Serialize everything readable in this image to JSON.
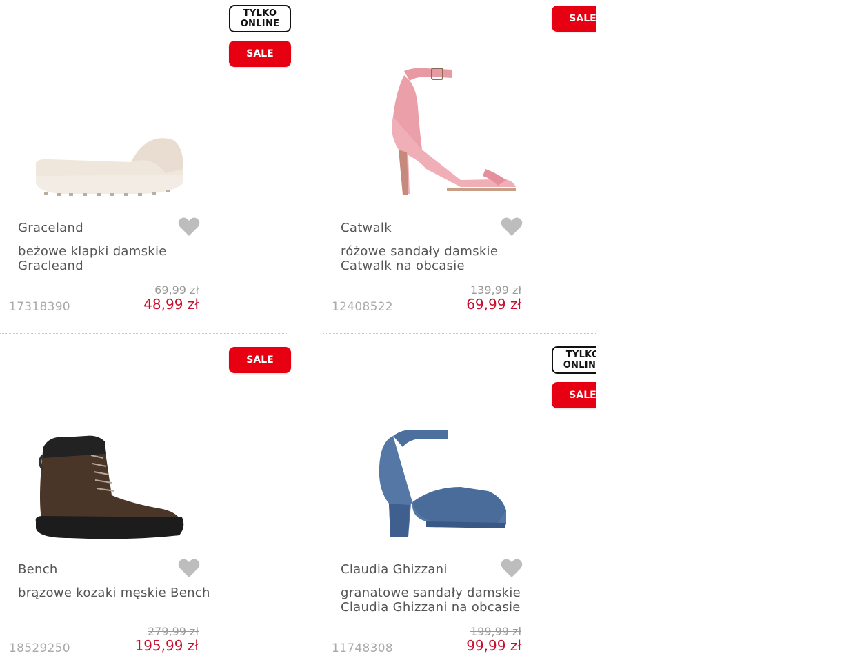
{
  "colors": {
    "sale_red": "#e60012",
    "price_red": "#c8102e",
    "text_gray": "#555555",
    "muted_gray": "#999999",
    "heart_gray": "#bdbdbd"
  },
  "badges": {
    "online_line1": "TYLKO",
    "online_line2": "ONLINE",
    "sale": "SALE"
  },
  "products": [
    {
      "brand": "Graceland",
      "name": "beżowe klapki damskie Gracleand",
      "old_price": "69,99 zł",
      "new_price": "48,99 zł",
      "sku": "17318390",
      "image_icon": "beige-slide-sandal",
      "badges": [
        "TYLKO ONLINE",
        "SALE"
      ]
    },
    {
      "brand": "Catwalk",
      "name": "różowe sandały damskie Catwalk na obcasie",
      "old_price": "139,99 zł",
      "new_price": "69,99 zł",
      "sku": "12408522",
      "image_icon": "pink-heeled-sandal",
      "badges": [
        "SALE"
      ]
    },
    {
      "brand": "Bench",
      "name": "brązowe kozaki męskie Bench",
      "old_price": "279,99 zł",
      "new_price": "195,99 zł",
      "sku": "18529250",
      "image_icon": "brown-ankle-boot",
      "badges": [
        "SALE"
      ]
    },
    {
      "brand": "Claudia Ghizzani",
      "name": "granatowe sandały damskie Claudia Ghizzani na obcasie",
      "old_price": "199,99 zł",
      "new_price": "99,99 zł",
      "sku": "11748308",
      "image_icon": "denim-platform-heel",
      "badges": [
        "TYLKO ONLINE",
        "SALE"
      ]
    }
  ]
}
